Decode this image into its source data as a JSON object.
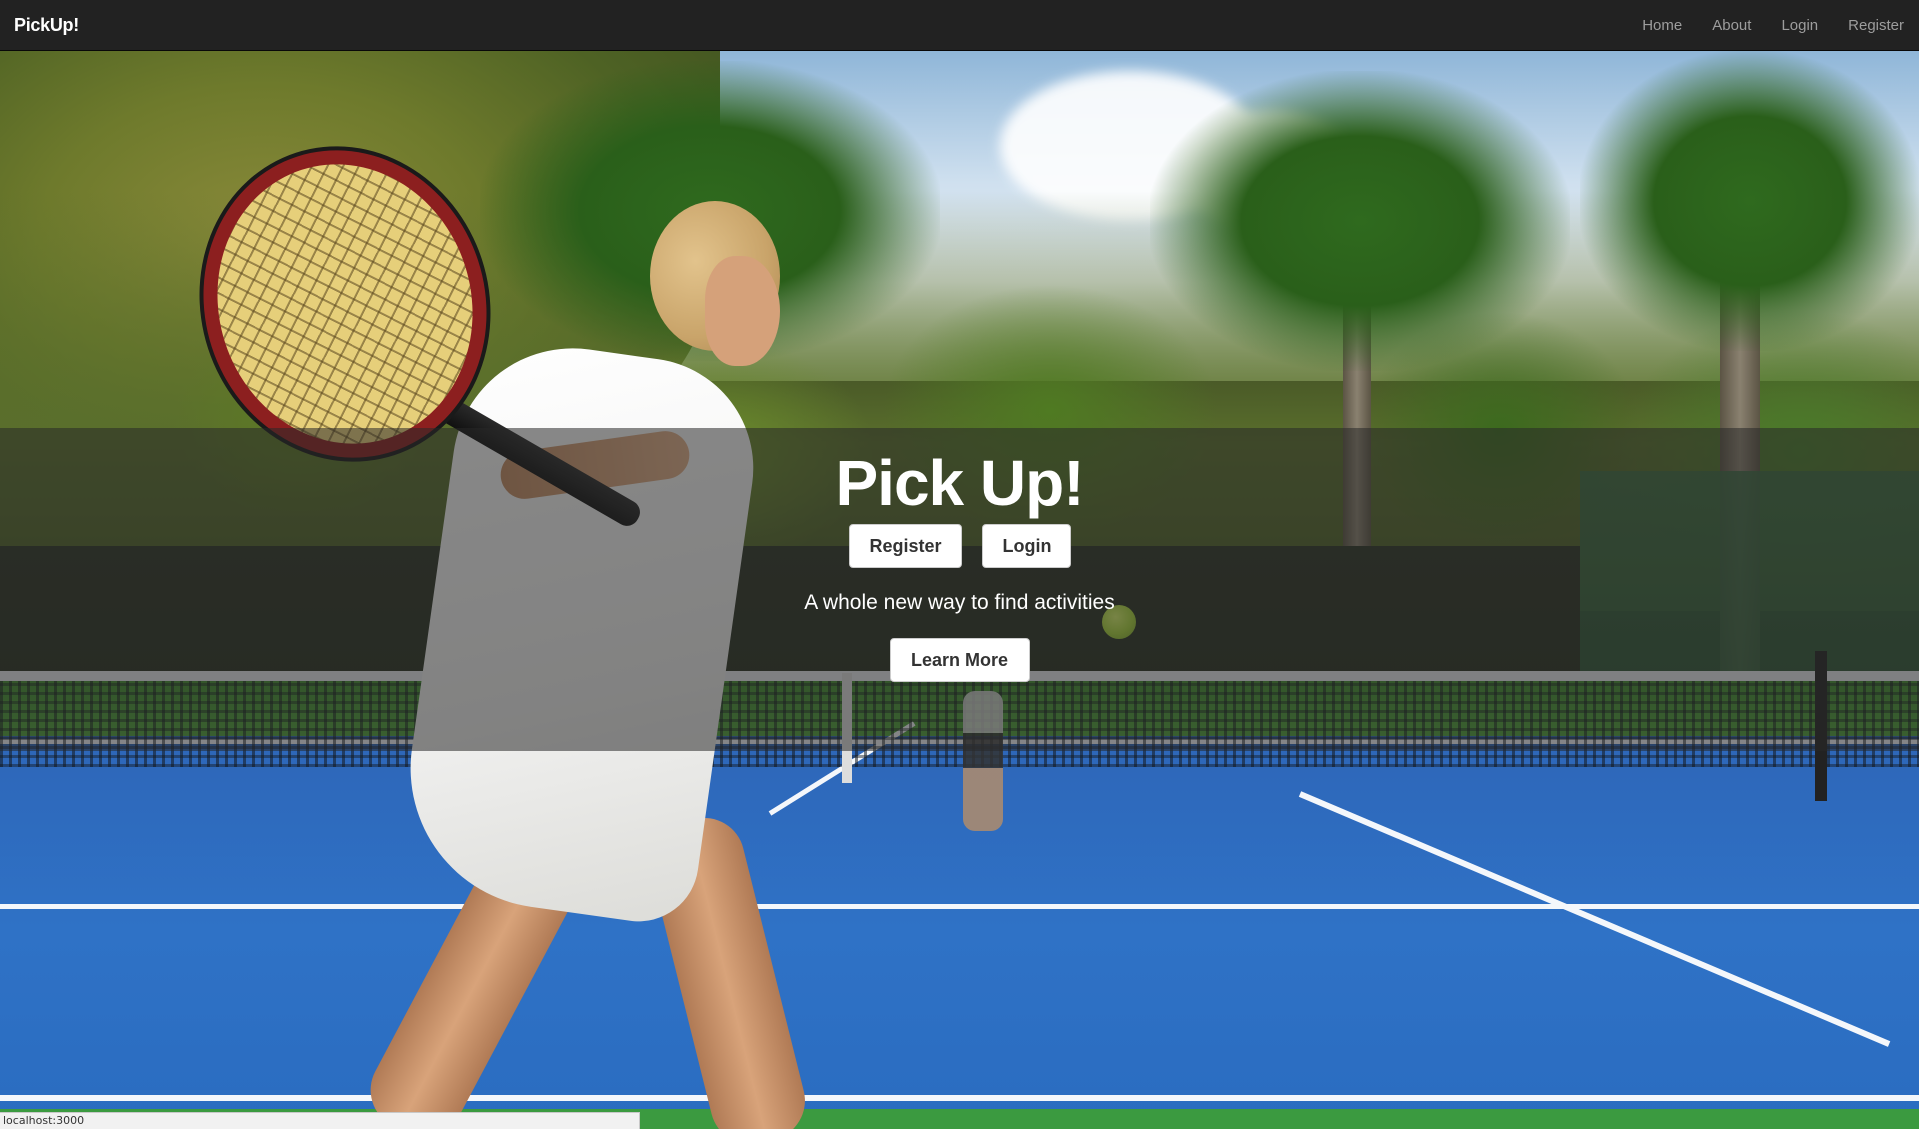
{
  "navbar": {
    "brand": "PickUp!",
    "links": [
      {
        "label": "Home"
      },
      {
        "label": "About"
      },
      {
        "label": "Login"
      },
      {
        "label": "Register"
      }
    ]
  },
  "hero": {
    "title": "Pick Up!",
    "register_label": "Register",
    "login_label": "Login",
    "tagline": "A whole new way to find activities",
    "learn_more_label": "Learn More"
  },
  "statusbar": {
    "url": "localhost:3000"
  },
  "colors": {
    "navbar_bg": "#222222",
    "nav_link": "#9d9d9d",
    "overlay": "rgba(40,40,40,0.55)",
    "button_bg": "#ffffff"
  }
}
